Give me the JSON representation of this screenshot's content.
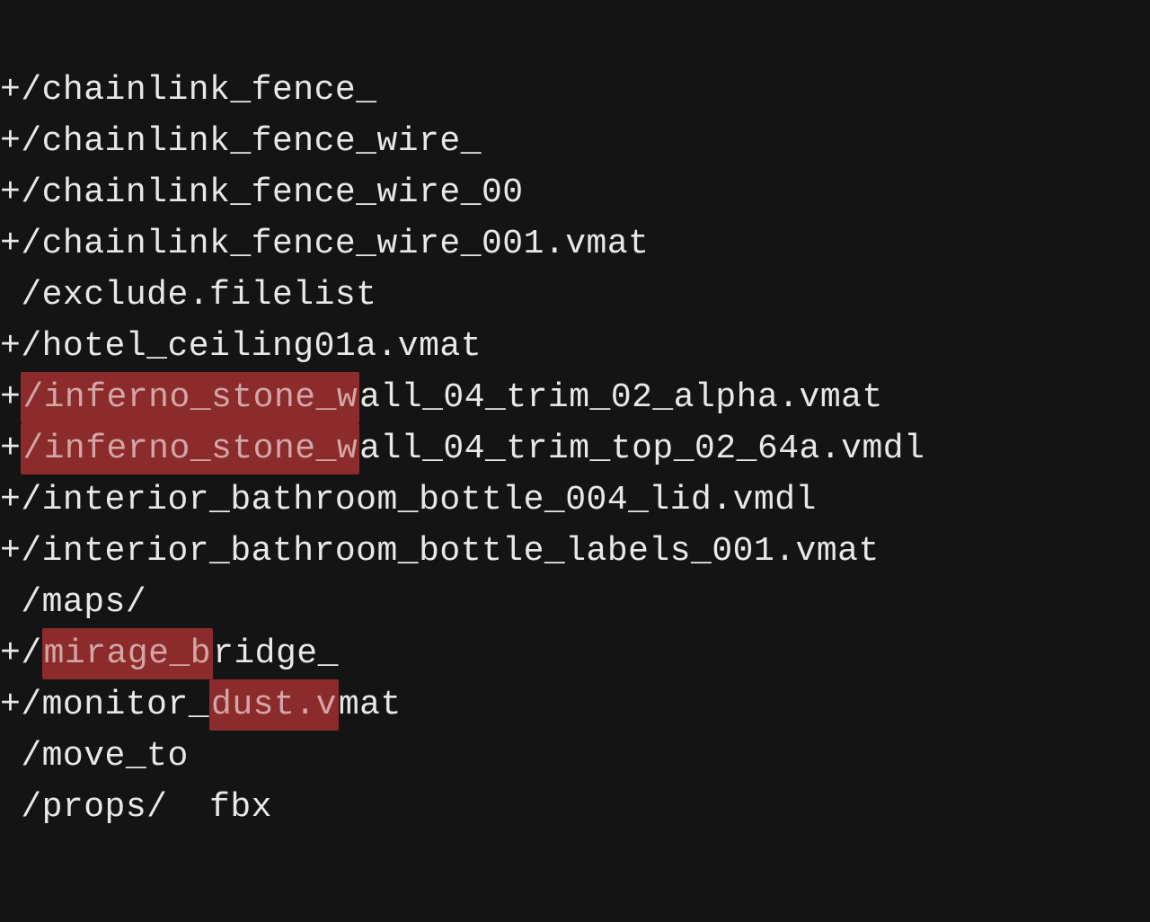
{
  "lines": [
    {
      "prefix": "+",
      "segments": [
        {
          "text": "/chainlink_fence_",
          "hl": false
        }
      ]
    },
    {
      "prefix": "+",
      "segments": [
        {
          "text": "/chainlink_fence_wire_",
          "hl": false
        }
      ]
    },
    {
      "prefix": "+",
      "segments": [
        {
          "text": "/chainlink_fence_wire_00",
          "hl": false
        }
      ]
    },
    {
      "prefix": "+",
      "segments": [
        {
          "text": "/chainlink_fence_wire_001.vmat",
          "hl": false
        }
      ]
    },
    {
      "prefix": " ",
      "segments": [
        {
          "text": "/exclude.filelist",
          "hl": false
        }
      ]
    },
    {
      "prefix": "+",
      "segments": [
        {
          "text": "/hotel_ceiling01a.vmat",
          "hl": false
        }
      ]
    },
    {
      "prefix": "+",
      "segments": [
        {
          "text": "/inferno_stone_w",
          "hl": true
        },
        {
          "text": "all_04_trim_02_alpha.vmat",
          "hl": false
        }
      ]
    },
    {
      "prefix": "+",
      "segments": [
        {
          "text": "/inferno_stone_w",
          "hl": true
        },
        {
          "text": "all_04_trim_top_02_64a.vmdl",
          "hl": false
        }
      ]
    },
    {
      "prefix": "+",
      "segments": [
        {
          "text": "/interior_bathroom_bottle_004_lid.vmdl",
          "hl": false
        }
      ]
    },
    {
      "prefix": "+",
      "segments": [
        {
          "text": "/interior_bathroom_bottle_labels_001.vmat",
          "hl": false
        }
      ]
    },
    {
      "prefix": " ",
      "segments": [
        {
          "text": "/maps/",
          "hl": false
        }
      ]
    },
    {
      "prefix": "+",
      "segments": [
        {
          "text": "/",
          "hl": false
        },
        {
          "text": "mirage_b",
          "hl": true
        },
        {
          "text": "ridge_",
          "hl": false
        }
      ]
    },
    {
      "prefix": "+",
      "segments": [
        {
          "text": "/monitor_",
          "hl": false
        },
        {
          "text": "dust.v",
          "hl": true
        },
        {
          "text": "mat",
          "hl": false
        }
      ]
    },
    {
      "prefix": " ",
      "segments": [
        {
          "text": "/move_to",
          "hl": false
        }
      ]
    },
    {
      "prefix": " ",
      "segments": [
        {
          "text": "/props/  fbx",
          "hl": false
        }
      ]
    }
  ]
}
